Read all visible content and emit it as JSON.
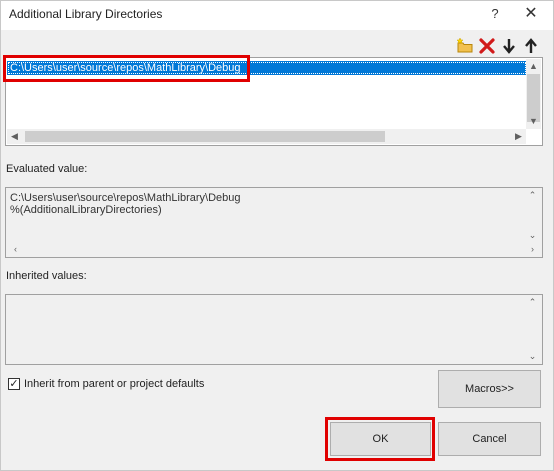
{
  "window": {
    "title": "Additional Library Directories",
    "help_glyph": "?",
    "close_glyph": "✕"
  },
  "toolbar": {
    "new_icon": "new-folder-icon",
    "delete_icon": "delete-icon",
    "move_down_icon": "move-down-icon",
    "move_up_icon": "move-up-icon"
  },
  "list": {
    "items": [
      "C:\\Users\\user\\source\\repos\\MathLibrary\\Debug"
    ]
  },
  "evaluated": {
    "label": "Evaluated value:",
    "lines": [
      "C:\\Users\\user\\source\\repos\\MathLibrary\\Debug",
      "%(AdditionalLibraryDirectories)"
    ]
  },
  "inherited": {
    "label": "Inherited values:"
  },
  "inherit_checkbox": {
    "label": "Inherit from parent or project defaults",
    "checked": true
  },
  "buttons": {
    "macros": "Macros>>",
    "ok": "OK",
    "cancel": "Cancel"
  },
  "colors": {
    "highlight_box": "#e00000",
    "selection": "#0078d7"
  }
}
